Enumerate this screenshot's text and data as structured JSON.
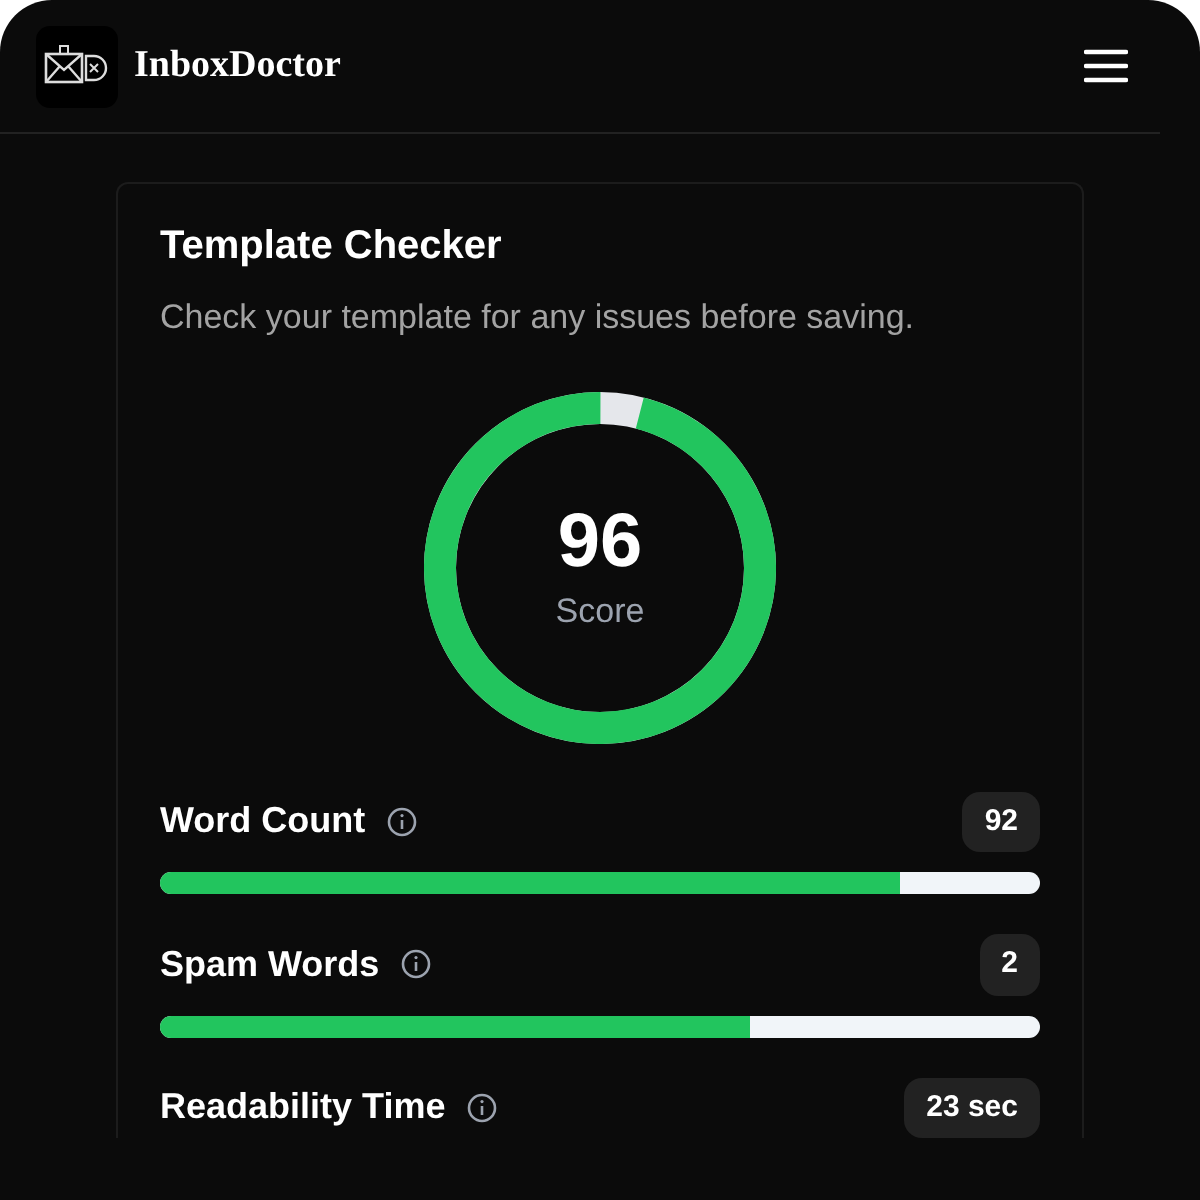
{
  "header": {
    "brand": "InboxDoctor"
  },
  "card": {
    "title": "Template Checker",
    "subtitle": "Check your template for any issues before saving."
  },
  "score": {
    "value": "96",
    "label": "Score",
    "level": 0.96
  },
  "metrics": [
    {
      "label": "Word Count",
      "badge": "92",
      "level": 0.84
    },
    {
      "label": "Spam Words",
      "badge": "2",
      "level": 0.67
    },
    {
      "label": "Readability Time",
      "badge": "23 sec"
    }
  ]
}
